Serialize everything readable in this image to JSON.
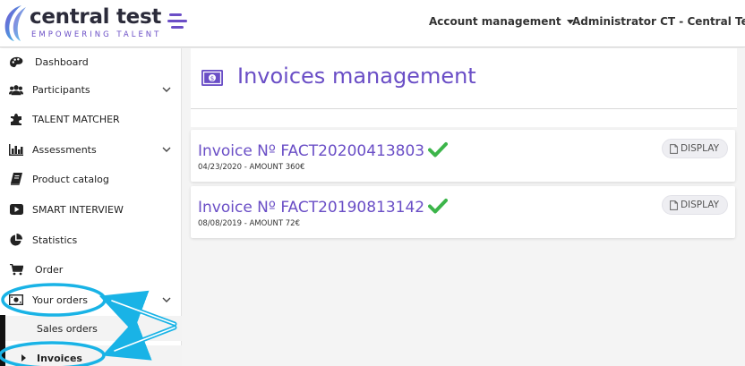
{
  "header": {
    "brand_name": "central test",
    "brand_tagline": "EMPOWERING TALENT",
    "menu_account": "Account management",
    "menu_admin": "Administrator CT - Central Test",
    "accent_color": "#6a4ec6"
  },
  "sidebar": {
    "items": [
      {
        "label": "Dashboard",
        "icon": "palette-icon"
      },
      {
        "label": "Participants",
        "icon": "users-icon",
        "expandable": true
      },
      {
        "label": "TALENT MATCHER",
        "icon": "puzzle-icon"
      },
      {
        "label": "Assessments",
        "icon": "bar-chart-icon",
        "expandable": true
      },
      {
        "label": "Product catalog",
        "icon": "book-icon"
      },
      {
        "label": "SMART INTERVIEW",
        "icon": "video-icon"
      },
      {
        "label": "Statistics",
        "icon": "pie-chart-icon"
      },
      {
        "label": "Order",
        "icon": "cart-icon"
      },
      {
        "label": "Your orders",
        "icon": "money-icon",
        "expandable": true
      }
    ],
    "sub_items": [
      {
        "label": "Sales orders",
        "active": false
      },
      {
        "label": "Invoices",
        "active": true
      }
    ]
  },
  "main": {
    "page_title": "Invoices management",
    "invoices": [
      {
        "title": "Invoice Nº FACT20200413803",
        "subtitle": "04/23/2020 - AMOUNT 360€",
        "button": "DISPLAY",
        "status": "check-icon"
      },
      {
        "title": "Invoice Nº FACT20190813142",
        "subtitle": "08/08/2019 - AMOUNT 72€",
        "button": "DISPLAY",
        "status": "check-icon"
      }
    ]
  },
  "annotation": {
    "highlight_color": "#19b3e6"
  }
}
